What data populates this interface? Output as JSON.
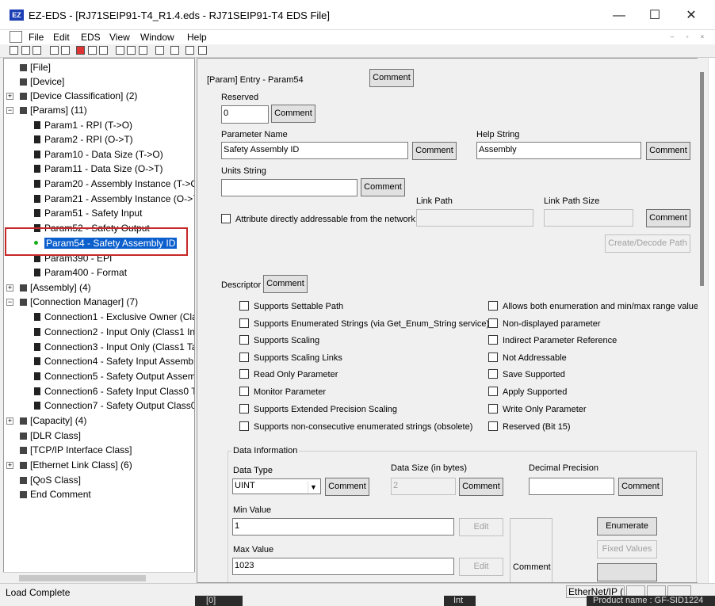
{
  "window": {
    "logo_text": "EZ",
    "title": "EZ-EDS - [RJ71SEIP91-T4_R1.4.eds - RJ71SEIP91-T4 EDS File]",
    "minimize": "—",
    "maximize": "☐",
    "close": "✕"
  },
  "menu": {
    "items": [
      "File",
      "Edit",
      "EDS",
      "View",
      "Window",
      "Help"
    ],
    "mdi_minimize": "–",
    "mdi_restore": "▫",
    "mdi_close": "×"
  },
  "tree": {
    "nodes": [
      {
        "label": "[File]"
      },
      {
        "label": "[Device]"
      },
      {
        "label": "[Device Classification] (2)"
      },
      {
        "label": "[Params] (11)"
      },
      {
        "label": "Param1 - RPI (T->O)"
      },
      {
        "label": "Param2 - RPI (O->T)"
      },
      {
        "label": "Param10 - Data Size (T->O)"
      },
      {
        "label": "Param11 - Data Size (O->T)"
      },
      {
        "label": "Param20 - Assembly Instance (T->C"
      },
      {
        "label": "Param21 - Assembly Instance (O->`"
      },
      {
        "label": "Param51 - Safety Input"
      },
      {
        "label": "Param52 - Safety Output"
      },
      {
        "label": "Param54 - Safety Assembly ID"
      },
      {
        "label": "Param390 - EPI"
      },
      {
        "label": "Param400 - Format"
      },
      {
        "label": "[Assembly] (4)"
      },
      {
        "label": "[Connection Manager] (7)"
      },
      {
        "label": "Connection1 - Exclusive Owner (Clas"
      },
      {
        "label": "Connection2 - Input Only (Class1 In"
      },
      {
        "label": "Connection3 - Input Only (Class1 Ta"
      },
      {
        "label": "Connection4 - Safety Input Assemb"
      },
      {
        "label": "Connection5 - Safety Output Assem"
      },
      {
        "label": "Connection6 - Safety Input Class0 T"
      },
      {
        "label": "Connection7 - Safety Output Class0"
      },
      {
        "label": "[Capacity] (4)"
      },
      {
        "label": "[DLR Class]"
      },
      {
        "label": "[TCP/IP Interface Class]"
      },
      {
        "label": "[Ethernet Link Class] (6)"
      },
      {
        "label": "[QoS Class]"
      },
      {
        "label": "End Comment"
      }
    ]
  },
  "form": {
    "entry_label": "[Param] Entry - Param54",
    "comment": "Comment",
    "reserved_label": "Reserved",
    "reserved_value": "0",
    "parameter_name_label": "Parameter Name",
    "parameter_name_value": "Safety Assembly ID",
    "help_string_label": "Help String",
    "help_string_value": "Assembly",
    "units_string_label": "Units String",
    "units_string_value": "",
    "link_path_label": "Link Path",
    "link_path_size_label": "Link Path Size",
    "attribute_checkbox": "Attribute directly addressable from the network:",
    "create_decode": "Create/Decode Path",
    "descriptor_label": "Descriptor",
    "descriptors_left": [
      "Supports Settable Path",
      "Supports Enumerated Strings (via Get_Enum_String service)",
      "Supports Scaling",
      "Supports Scaling Links",
      "Read Only Parameter",
      "Monitor Parameter",
      "Supports Extended Precision Scaling",
      "Supports non-consecutive enumerated strings (obsolete)"
    ],
    "descriptors_right": [
      "Allows both enumeration and min/max range values",
      "Non-displayed parameter",
      "Indirect Parameter Reference",
      "Not Addressable",
      "Save Supported",
      "Apply Supported",
      "Write Only Parameter",
      "Reserved (Bit 15)"
    ],
    "data_info_label": "Data Information",
    "data_type_label": "Data Type",
    "data_type_value": "UINT",
    "data_size_label": "Data Size (in bytes)",
    "data_size_value": "2",
    "decimal_precision_label": "Decimal Precision",
    "decimal_precision_value": "",
    "min_value_label": "Min Value",
    "min_value": "1",
    "max_value_label": "Max Value",
    "max_value": "1023",
    "edit": "Edit",
    "enumerate": "Enumerate",
    "fixed_values": "Fixed Values"
  },
  "status": {
    "text": "Load Complete",
    "network": "EtherNet/IP (‘"
  },
  "background": {
    "strip1": "[0]",
    "strip2": "Int",
    "strip3": "Product name : GF-SID1224"
  }
}
